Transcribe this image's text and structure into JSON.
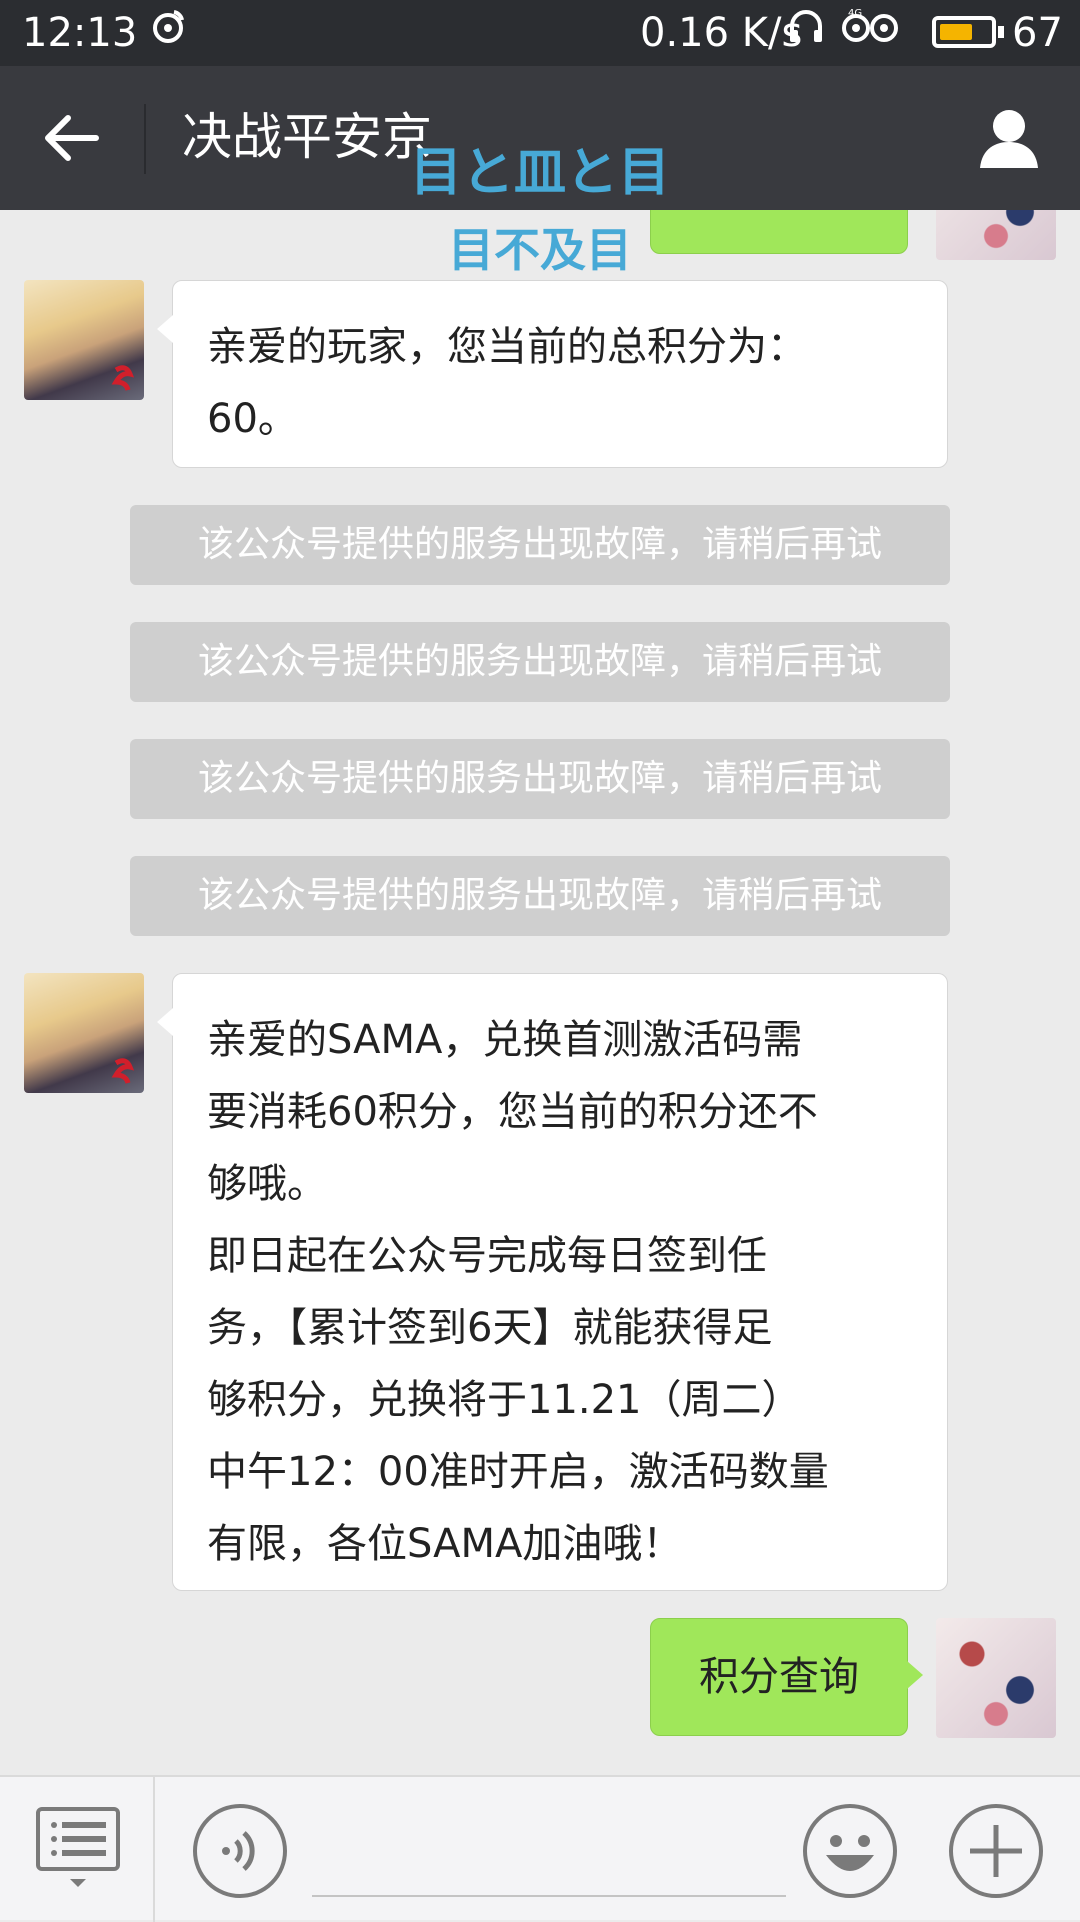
{
  "status_bar": {
    "time": "12:13",
    "network_speed": "0.16 K/s",
    "battery_percent": "67",
    "battery_level": 0.67
  },
  "nav": {
    "title": "决战平安京",
    "watermark_line1": "目と皿と目",
    "watermark_line2": "目不及目"
  },
  "messages": [
    {
      "type": "incoming",
      "lines": [
        "亲爱的玩家，您当前的总积分为：",
        "60。"
      ]
    },
    {
      "type": "system",
      "text": "该公众号提供的服务出现故障，请稍后再试"
    },
    {
      "type": "system",
      "text": "该公众号提供的服务出现故障，请稍后再试"
    },
    {
      "type": "system",
      "text": "该公众号提供的服务出现故障，请稍后再试"
    },
    {
      "type": "system",
      "text": "该公众号提供的服务出现故障，请稍后再试"
    },
    {
      "type": "incoming",
      "lines": [
        "亲爱的SAMA，兑换首测激活码需",
        "要消耗60积分，您当前的积分还不",
        "够哦。",
        "即日起在公众号完成每日签到任",
        "务，【累计签到6天】就能获得足",
        "够积分，兑换将于11.21（周二）",
        "中午12：00准时开启，激活码数量",
        "有限，各位SAMA加油哦！"
      ]
    },
    {
      "type": "outgoing",
      "text": "积分查询"
    }
  ],
  "input_bar": {
    "placeholder": ""
  }
}
